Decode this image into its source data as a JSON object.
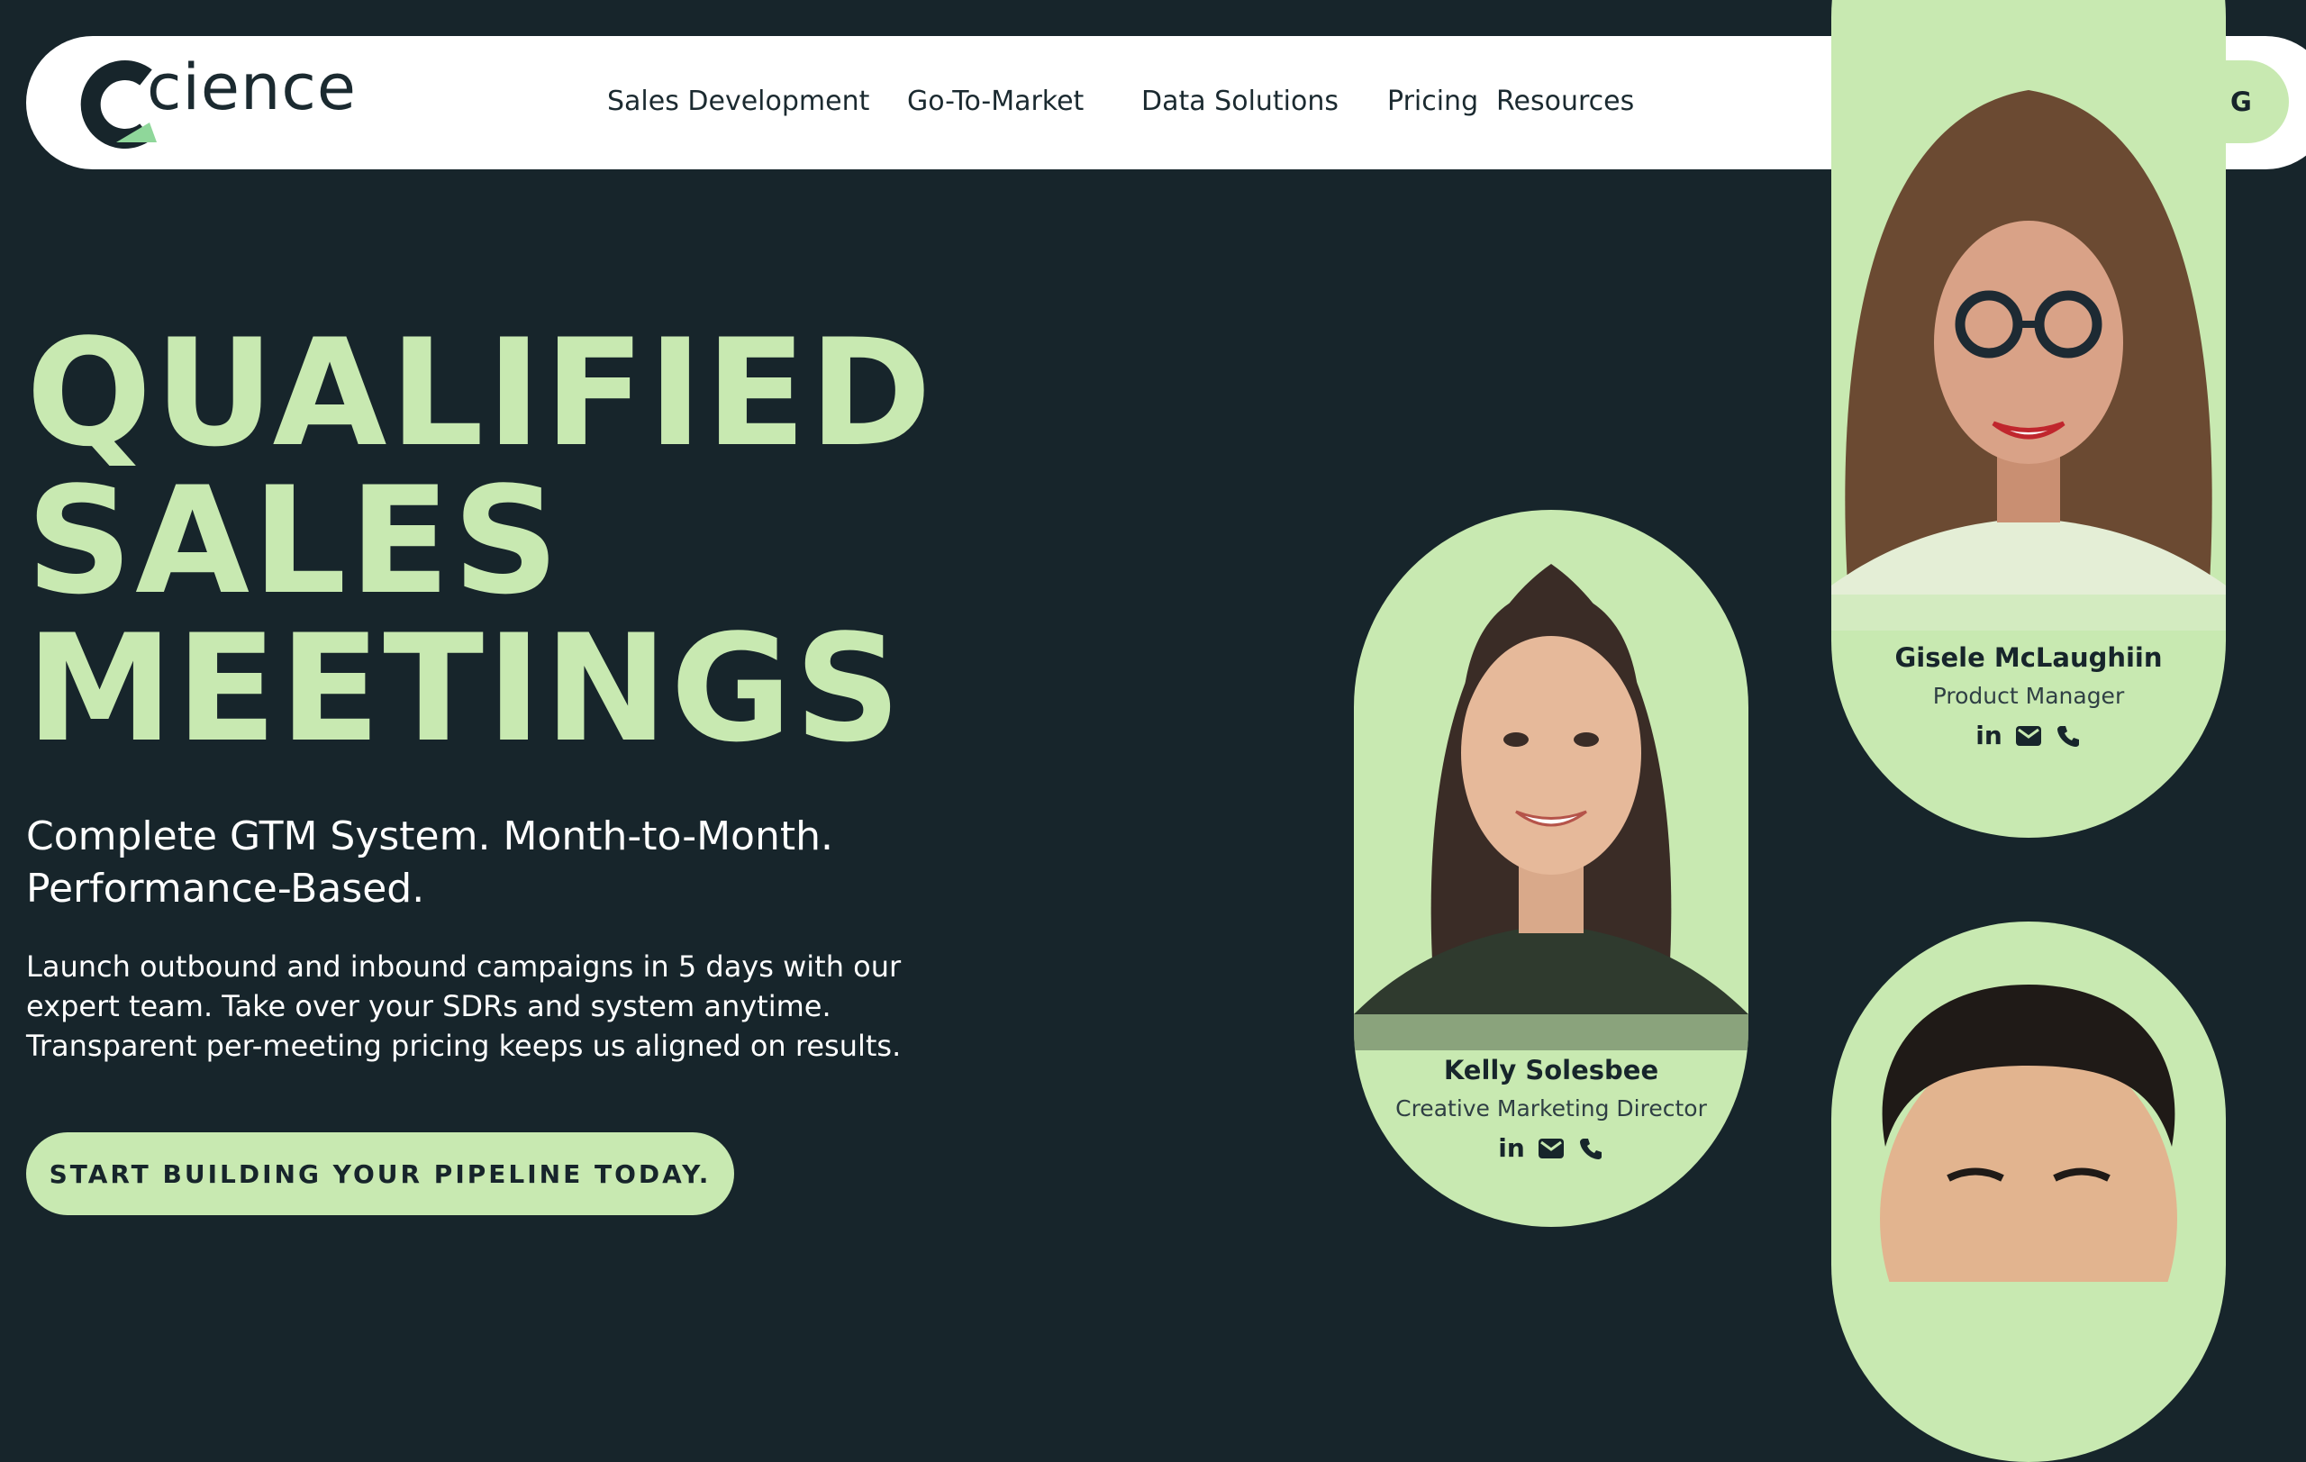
{
  "brand": {
    "name": "cience",
    "accent": "#c8e9b1",
    "background": "#17252b"
  },
  "nav": {
    "items": [
      {
        "label": "Sales Development"
      },
      {
        "label": "Go-To-Market"
      },
      {
        "label": "Data Solutions"
      },
      {
        "label": "Pricing"
      },
      {
        "label": "Resources"
      }
    ],
    "book_label": "BOOK A MEETING"
  },
  "hero": {
    "headline": [
      "QUALIFIED",
      "SALES",
      "MEETINGS"
    ],
    "subhead": [
      "Complete GTM System. Month-to-Month.",
      "Performance-Based."
    ],
    "body": "Launch outbound and inbound campaigns in 5 days with our expert team. Take over your SDRs and system anytime. Transparent per-meeting pricing keeps us aligned on results.",
    "cta_label": "START BUILDING YOUR PIPELINE TODAY."
  },
  "profiles": [
    {
      "name": "Kelly Solesbee",
      "role": "Creative Marketing Director",
      "icons": [
        "linkedin-icon",
        "mail-icon",
        "phone-icon"
      ]
    },
    {
      "name": "Gisele McLaughiin",
      "role": "Product Manager",
      "icons": [
        "linkedin-icon",
        "mail-icon",
        "phone-icon"
      ]
    }
  ]
}
